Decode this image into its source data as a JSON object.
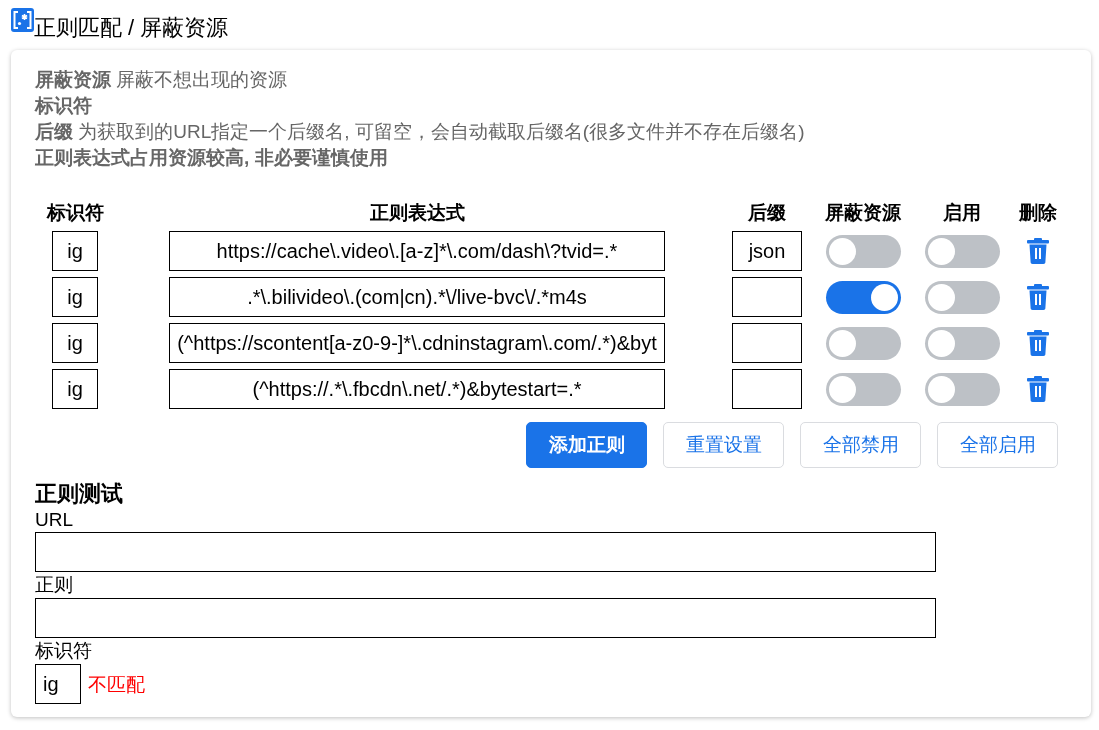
{
  "header": {
    "title": "正则匹配 / 屏蔽资源"
  },
  "help": {
    "items": [
      {
        "term": "屏蔽资源",
        "description": "屏蔽不想出现的资源"
      },
      {
        "term": "标识符"
      },
      {
        "term": "后缀",
        "description": "为获取到的URL指定一个后缀名, 可留空，会自动截取后缀名(很多文件并不存在后缀名)"
      }
    ],
    "warning": "正则表达式占用资源较高, 非必要谨慎使用"
  },
  "table": {
    "columns": [
      "标识符",
      "正则表达式",
      "后缀",
      "屏蔽资源",
      "启用",
      "删除"
    ],
    "rows": [
      {
        "identifier": "ig",
        "regex": "https://cache\\.video\\.[a-z]*\\.com/dash\\?tvid=.*",
        "suffix": "json",
        "blocked": false,
        "enabled": false
      },
      {
        "identifier": "ig",
        "regex": ".*\\.bilivideo\\.(com|cn).*\\/live-bvc\\/.*m4s",
        "blocked": true,
        "enabled": false
      },
      {
        "identifier": "ig",
        "regex": "(^https://scontent[a-z0-9-]*\\.cdninstagram\\.com/.*)&byt",
        "blocked": false,
        "enabled": false
      },
      {
        "identifier": "ig",
        "regex": "(^https://.*\\.fbcdn\\.net/.*)&bytestart=.*",
        "blocked": false,
        "enabled": false
      }
    ]
  },
  "buttons": [
    {
      "label": "添加正则",
      "kind": "primary"
    },
    {
      "label": "重置设置",
      "kind": "secondary"
    },
    {
      "label": "全部禁用",
      "kind": "secondary"
    },
    {
      "label": "全部启用",
      "kind": "secondary"
    }
  ],
  "test": {
    "title": "正则测试",
    "url_field": {
      "label": "URL"
    },
    "regex_field": {
      "label": "正则"
    },
    "identifier_field": {
      "label": "标识符",
      "value": "ig"
    },
    "result": {
      "text": "不匹配",
      "matched": false
    }
  }
}
